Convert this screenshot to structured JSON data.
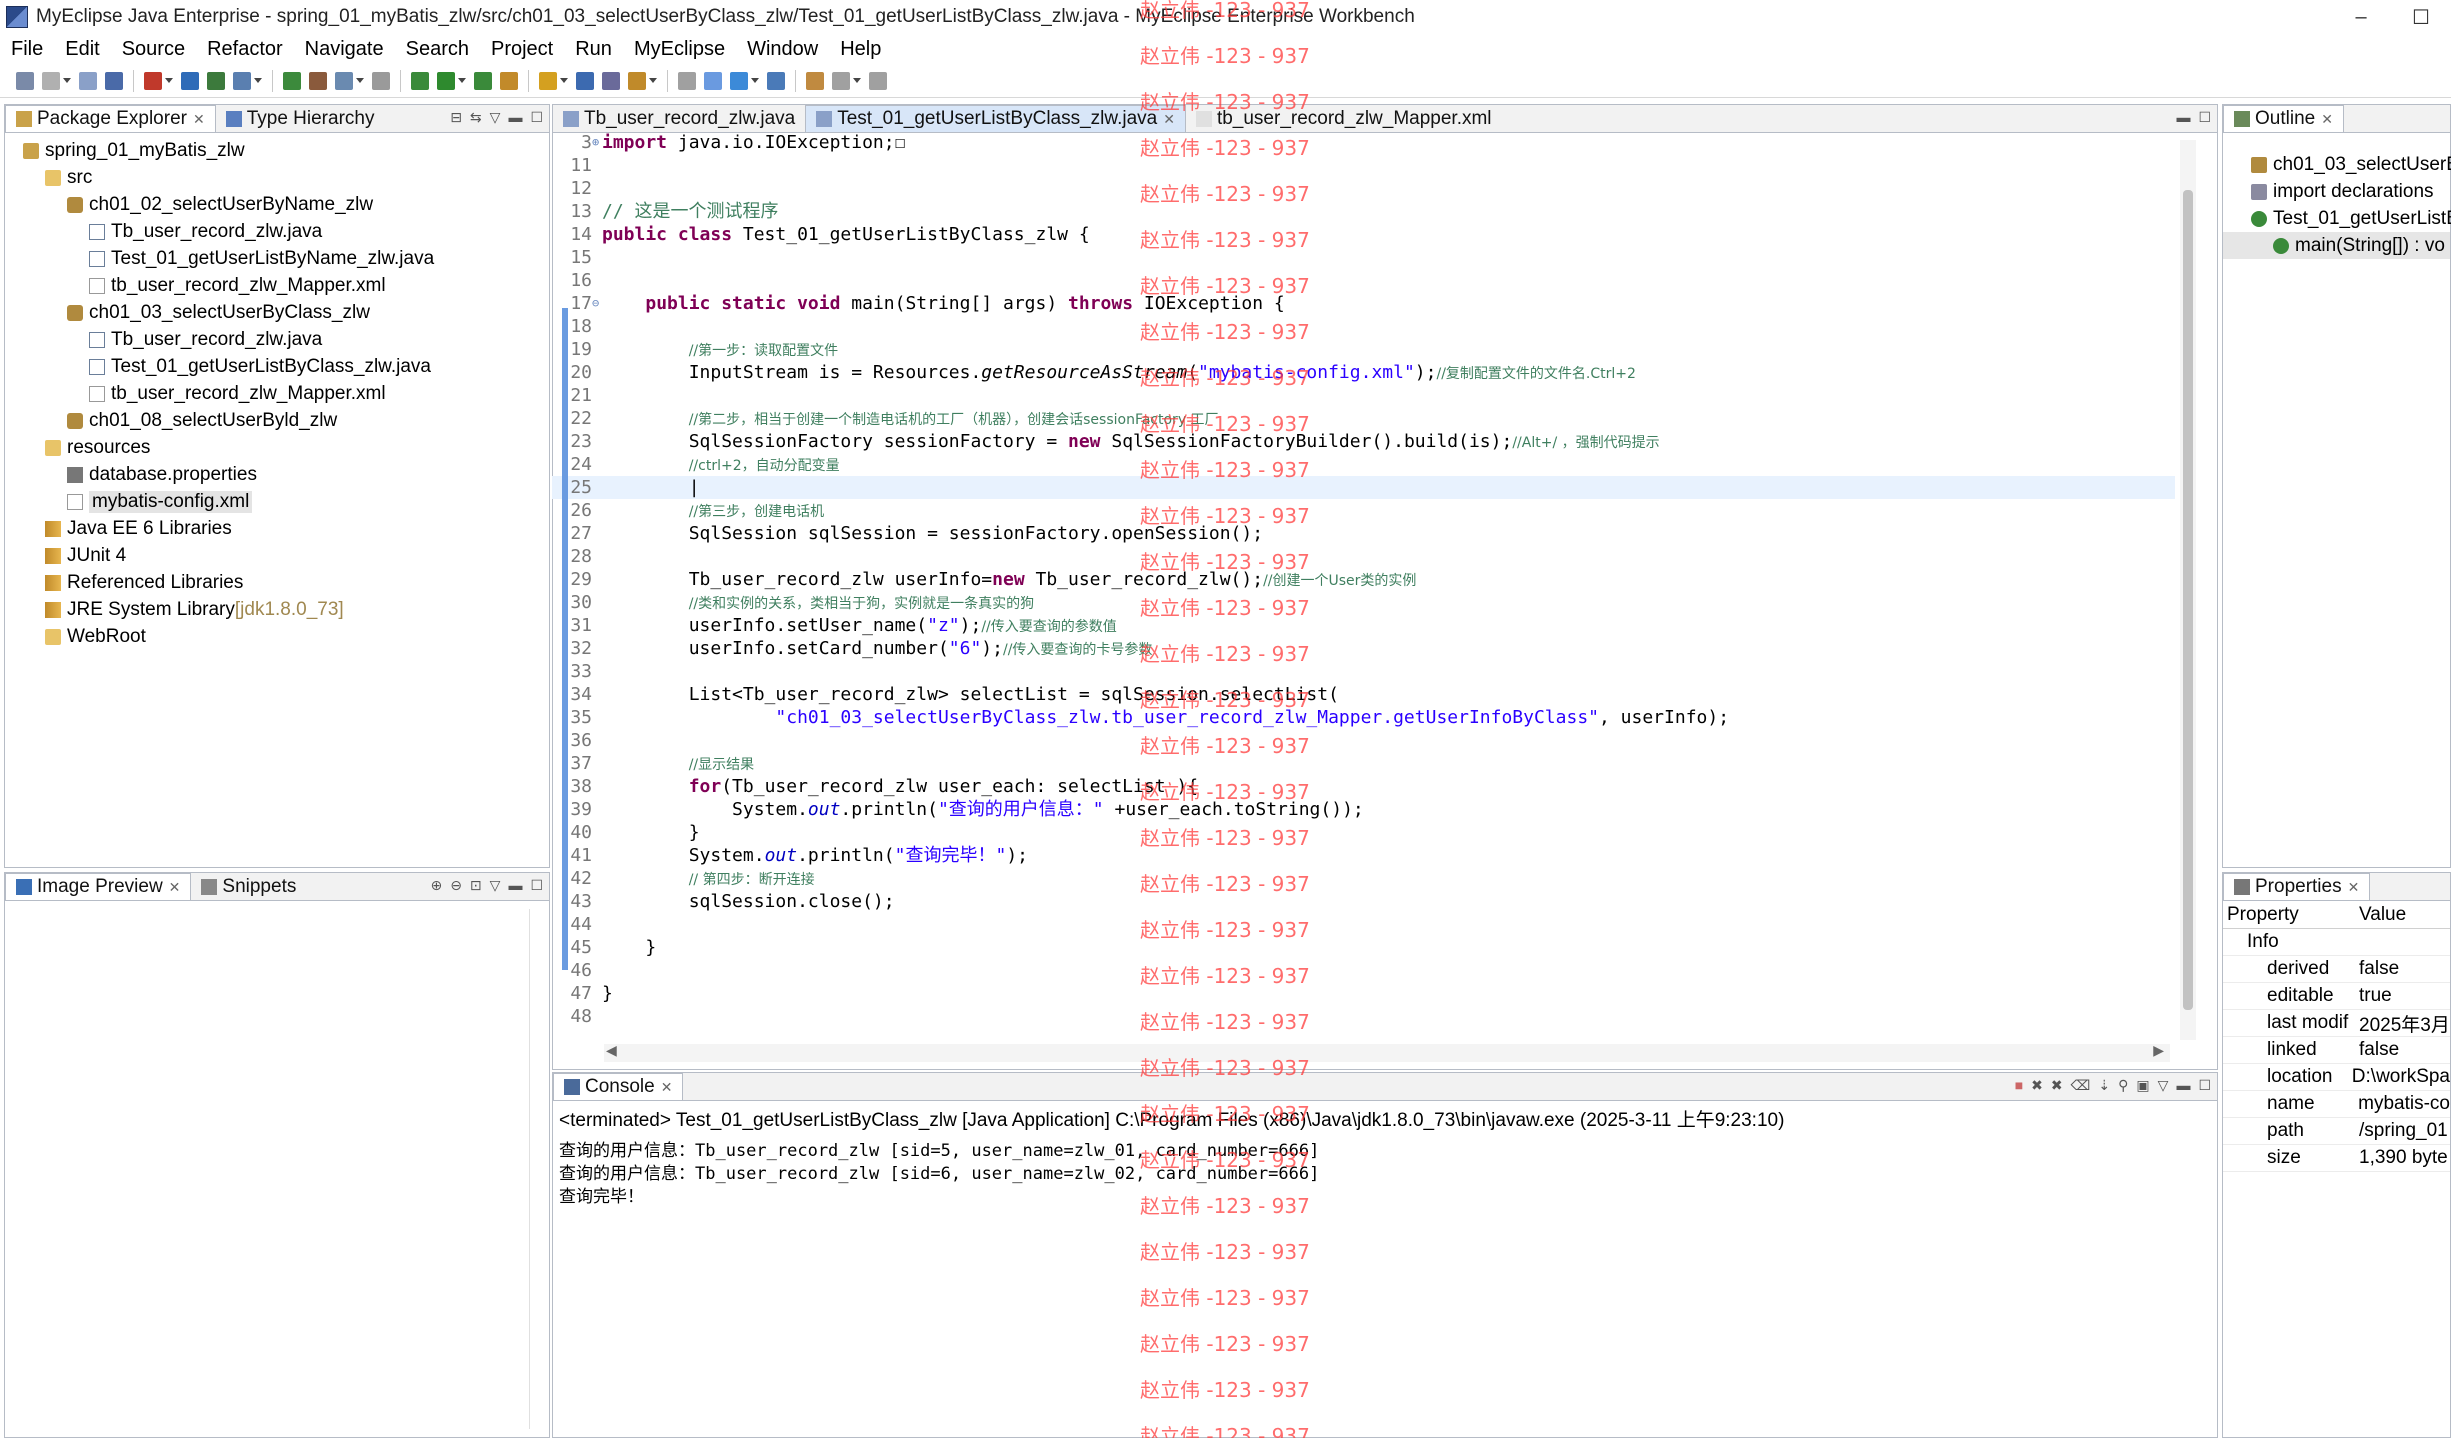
{
  "window": {
    "title": "MyEclipse Java Enterprise - spring_01_myBatis_zlw/src/ch01_03_selectUserByClass_zlw/Test_01_getUserListByClass_zlw.java - MyEclipse Enterprise Workbench",
    "minimize": "–",
    "maximize": "☐"
  },
  "menu": [
    "File",
    "Edit",
    "Source",
    "Refactor",
    "Navigate",
    "Search",
    "Project",
    "Run",
    "MyEclipse",
    "Window",
    "Help"
  ],
  "package_explorer": {
    "tabs": [
      "Package Explorer",
      "Type Hierarchy"
    ],
    "tree": [
      {
        "indent": 0,
        "icon": "project",
        "label": "spring_01_myBatis_zlw"
      },
      {
        "indent": 1,
        "icon": "folder",
        "label": "src"
      },
      {
        "indent": 2,
        "icon": "pkg",
        "label": "ch01_02_selectUserByName_zlw"
      },
      {
        "indent": 3,
        "icon": "java",
        "label": "Tb_user_record_zlw.java"
      },
      {
        "indent": 3,
        "icon": "java",
        "label": "Test_01_getUserListByName_zlw.java"
      },
      {
        "indent": 3,
        "icon": "xml",
        "label": "tb_user_record_zlw_Mapper.xml"
      },
      {
        "indent": 2,
        "icon": "pkg",
        "label": "ch01_03_selectUserByClass_zlw"
      },
      {
        "indent": 3,
        "icon": "java",
        "label": "Tb_user_record_zlw.java"
      },
      {
        "indent": 3,
        "icon": "java",
        "label": "Test_01_getUserListByClass_zlw.java"
      },
      {
        "indent": 3,
        "icon": "xml",
        "label": "tb_user_record_zlw_Mapper.xml"
      },
      {
        "indent": 2,
        "icon": "pkg",
        "label": "ch01_08_selectUserByld_zlw"
      },
      {
        "indent": 1,
        "icon": "folder",
        "label": "resources"
      },
      {
        "indent": 2,
        "icon": "props",
        "label": "database.properties"
      },
      {
        "indent": 2,
        "icon": "xml",
        "label": "mybatis-config.xml",
        "selected": true
      },
      {
        "indent": 1,
        "icon": "lib",
        "label": "Java EE 6 Libraries"
      },
      {
        "indent": 1,
        "icon": "lib",
        "label": "JUnit 4"
      },
      {
        "indent": 1,
        "icon": "lib",
        "label": "Referenced Libraries"
      },
      {
        "indent": 1,
        "icon": "lib",
        "label": "JRE System Library",
        "suffix": "[jdk1.8.0_73]"
      },
      {
        "indent": 1,
        "icon": "folder",
        "label": "WebRoot"
      }
    ]
  },
  "image_preview": {
    "tabs": [
      "Image Preview",
      "Snippets"
    ]
  },
  "editor": {
    "tabs": [
      "Tb_user_record_zlw.java",
      "Test_01_getUserListByClass_zlw.java",
      "tb_user_record_zlw_Mapper.xml"
    ],
    "active_tab": 1,
    "lines": [
      {
        "n": "3",
        "fold": "⊕",
        "html": "<span class=\"kw\">import</span> java.io.IOException;☐"
      },
      {
        "n": "11",
        "html": ""
      },
      {
        "n": "12",
        "html": ""
      },
      {
        "n": "13",
        "html": "<span class=\"cm\">// 这是一个测试程序</span>"
      },
      {
        "n": "14",
        "html": "<span class=\"kw\">public class</span> Test_01_getUserListByClass_zlw {"
      },
      {
        "n": "15",
        "html": ""
      },
      {
        "n": "16",
        "html": ""
      },
      {
        "n": "17",
        "fold": "⊖",
        "html": "    <span class=\"kw\">public static void</span> main(String[] args) <span class=\"kw\">throws</span> IOException {"
      },
      {
        "n": "18",
        "html": ""
      },
      {
        "n": "19",
        "html": "        <span class=\"cm-small\">//第一步：读取配置文件</span>"
      },
      {
        "n": "20",
        "html": "        InputStream is = Resources.<span class=\"it\">getResourceAsStream</span>(<span class=\"str\">\"mybatis-config.xml\"</span>);<span class=\"cm-small\">//复制配置文件的文件名.Ctrl+2</span>"
      },
      {
        "n": "21",
        "html": ""
      },
      {
        "n": "22",
        "html": "        <span class=\"cm-small\">//第二步，相当于创建一个制造电话机的工厂（机器），创建会话sessionFactory 工厂</span>"
      },
      {
        "n": "23",
        "html": "        SqlSessionFactory sessionFactory = <span class=\"kw\">new</span> SqlSessionFactoryBuilder().build(is);<span class=\"cm-small\">//Alt+/ ，强制代码提示</span>"
      },
      {
        "n": "24",
        "html": "        <span class=\"cm-small\">//ctrl+2，自动分配变量</span>"
      },
      {
        "n": "25",
        "html": "        |",
        "current": true
      },
      {
        "n": "26",
        "html": "        <span class=\"cm-small\">//第三步，创建电话机</span>"
      },
      {
        "n": "27",
        "html": "        SqlSession sqlSession = sessionFactory.openSession();"
      },
      {
        "n": "28",
        "html": ""
      },
      {
        "n": "29",
        "html": "        Tb_user_record_zlw userInfo=<span class=\"kw\">new</span> Tb_user_record_zlw();<span class=\"cm-small\">//创建一个User类的实例</span>"
      },
      {
        "n": "30",
        "html": "        <span class=\"cm-small\">//类和实例的关系，类相当于狗，实例就是一条真实的狗</span>"
      },
      {
        "n": "31",
        "html": "        userInfo.setUser_name(<span class=\"str\">\"z\"</span>);<span class=\"cm-small\">//传入要查询的参数值</span>"
      },
      {
        "n": "32",
        "html": "        userInfo.setCard_number(<span class=\"str\">\"6\"</span>);<span class=\"cm-small\">//传入要查询的卡号参数</span>"
      },
      {
        "n": "33",
        "html": ""
      },
      {
        "n": "34",
        "html": "        List&lt;Tb_user_record_zlw&gt; selectList = sqlSession.selectList("
      },
      {
        "n": "35",
        "html": "                <span class=\"str\">\"ch01_03_selectUserByClass_zlw.tb_user_record_zlw_Mapper.getUserInfoByClass\"</span>, userInfo);"
      },
      {
        "n": "36",
        "html": ""
      },
      {
        "n": "37",
        "html": "        <span class=\"cm-small\">//显示结果</span>"
      },
      {
        "n": "38",
        "html": "        <span class=\"kw\">for</span>(Tb_user_record_zlw user_each: selectList ){"
      },
      {
        "n": "39",
        "html": "            System.<span class=\"fld\">out</span>.println(<span class=\"str\">\"查询的用户信息：\"</span> +user_each.toString());"
      },
      {
        "n": "40",
        "html": "        }"
      },
      {
        "n": "41",
        "html": "        System.<span class=\"fld\">out</span>.println(<span class=\"str\">\"查询完毕！\"</span>);"
      },
      {
        "n": "42",
        "html": "        <span class=\"cm-small\">// 第四步：断开连接</span>"
      },
      {
        "n": "43",
        "html": "        sqlSession.close();"
      },
      {
        "n": "44",
        "html": ""
      },
      {
        "n": "45",
        "html": "    }"
      },
      {
        "n": "46",
        "html": ""
      },
      {
        "n": "47",
        "html": "}"
      },
      {
        "n": "48",
        "html": ""
      }
    ]
  },
  "console": {
    "tab": "Console",
    "header": "<terminated> Test_01_getUserListByClass_zlw [Java Application] C:\\Program Files (x86)\\Java\\jdk1.8.0_73\\bin\\javaw.exe (2025-3-11 上午9:23:10)",
    "lines": [
      "查询的用户信息：Tb_user_record_zlw [sid=5, user_name=zlw_01, card_number=666]",
      "查询的用户信息：Tb_user_record_zlw [sid=6, user_name=zlw_02, card_number=666]",
      "查询完毕！"
    ]
  },
  "outline": {
    "tab": "Outline",
    "items": [
      "ch01_03_selectUserB",
      "import declarations",
      "Test_01_getUserListB",
      "main(String[]) : vo"
    ]
  },
  "properties": {
    "tab": "Properties",
    "col_property": "Property",
    "col_value": "Value",
    "group": "Info",
    "rows": [
      {
        "k": "derived",
        "v": "false"
      },
      {
        "k": "editable",
        "v": "true"
      },
      {
        "k": "last modif",
        "v": "2025年3月"
      },
      {
        "k": "linked",
        "v": "false"
      },
      {
        "k": "location",
        "v": "D:\\workSpa"
      },
      {
        "k": "name",
        "v": "mybatis-co"
      },
      {
        "k": "path",
        "v": "/spring_01"
      },
      {
        "k": "size",
        "v": "1,390  byte"
      }
    ]
  },
  "watermark": "赵立伟 -123 - 937"
}
